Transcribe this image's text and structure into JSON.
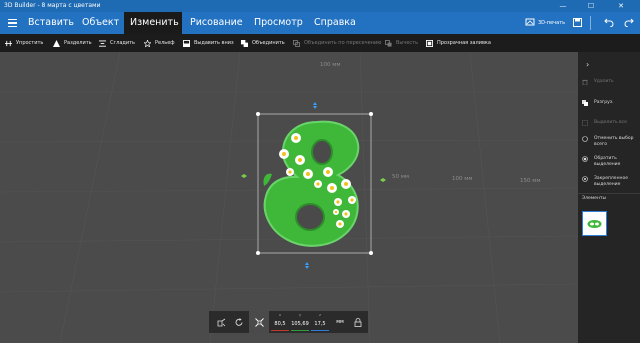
{
  "window": {
    "title": "3D Builder - 8 марта с цветами",
    "minimize": "—",
    "maximize": "☐",
    "close": "✕"
  },
  "menu": {
    "tabs": [
      {
        "label": "Вставить"
      },
      {
        "label": "Объект"
      },
      {
        "label": "Изменить"
      },
      {
        "label": "Рисование"
      },
      {
        "label": "Просмотр"
      },
      {
        "label": "Справка"
      }
    ],
    "active_tab": "Изменить",
    "print_label": "3D-печать"
  },
  "toolbar": {
    "items": [
      {
        "label": "Упростить",
        "icon": "simplify-icon",
        "enabled": true
      },
      {
        "label": "Разделить",
        "icon": "split-icon",
        "enabled": true
      },
      {
        "label": "Сгладить",
        "icon": "smooth-icon",
        "enabled": true
      },
      {
        "label": "Рельеф",
        "icon": "emboss-icon",
        "enabled": true
      },
      {
        "label": "Выдавить вниз",
        "icon": "extrude-down-icon",
        "enabled": true
      },
      {
        "label": "Объединить",
        "icon": "merge-icon",
        "enabled": true
      },
      {
        "label": "Объединить по пересечению",
        "icon": "intersect-icon",
        "enabled": false
      },
      {
        "label": "Вычесть",
        "icon": "subtract-icon",
        "enabled": false
      },
      {
        "label": "Прозрачная заливка",
        "icon": "fill-icon",
        "enabled": true
      }
    ]
  },
  "viewport": {
    "ruler_labels": [
      "100 мм",
      "50 мм",
      "100 мм",
      "150 мм"
    ]
  },
  "panel": {
    "items": [
      {
        "label": "Удалить",
        "icon": "delete-icon",
        "enabled": false
      },
      {
        "label": "Разгруз.",
        "icon": "duplicate-icon",
        "enabled": true
      },
      {
        "label": "Выделить все",
        "icon": "select-all-icon",
        "enabled": false
      },
      {
        "label": "Отменить выбор всего",
        "icon": "deselect-icon",
        "enabled": true
      },
      {
        "label": "Обратить выделение",
        "icon": "invert-icon",
        "enabled": true
      },
      {
        "label": "Закрепленное выделение",
        "icon": "sticky-select-icon",
        "enabled": true
      }
    ],
    "elements_title": "Элементы"
  },
  "transform": {
    "x": {
      "label": "x",
      "value": "80,5"
    },
    "y": {
      "label": "y",
      "value": "105,69"
    },
    "z": {
      "label": "z",
      "value": "17,5"
    },
    "unit": "мм"
  }
}
